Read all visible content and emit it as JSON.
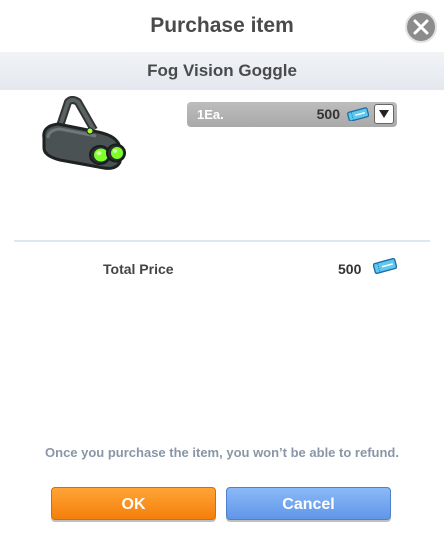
{
  "dialog": {
    "title": "Purchase item",
    "item_name": "Fog Vision Goggle"
  },
  "quantity_select": {
    "selected": "1Ea.",
    "price": "500"
  },
  "total": {
    "label": "Total Price",
    "value": "500"
  },
  "refund_note": "Once you purchase the item, you won’t be able to refund.",
  "buttons": {
    "ok": "OK",
    "cancel": "Cancel"
  },
  "icons": {
    "close": "close-icon",
    "item": "fog-vision-goggle-icon",
    "currency": "ticket-icon",
    "dropdown": "chevron-down-icon"
  },
  "colors": {
    "ok_button": "#f7901e",
    "cancel_button": "#6fa4ee",
    "note_text": "#8a96a8"
  }
}
